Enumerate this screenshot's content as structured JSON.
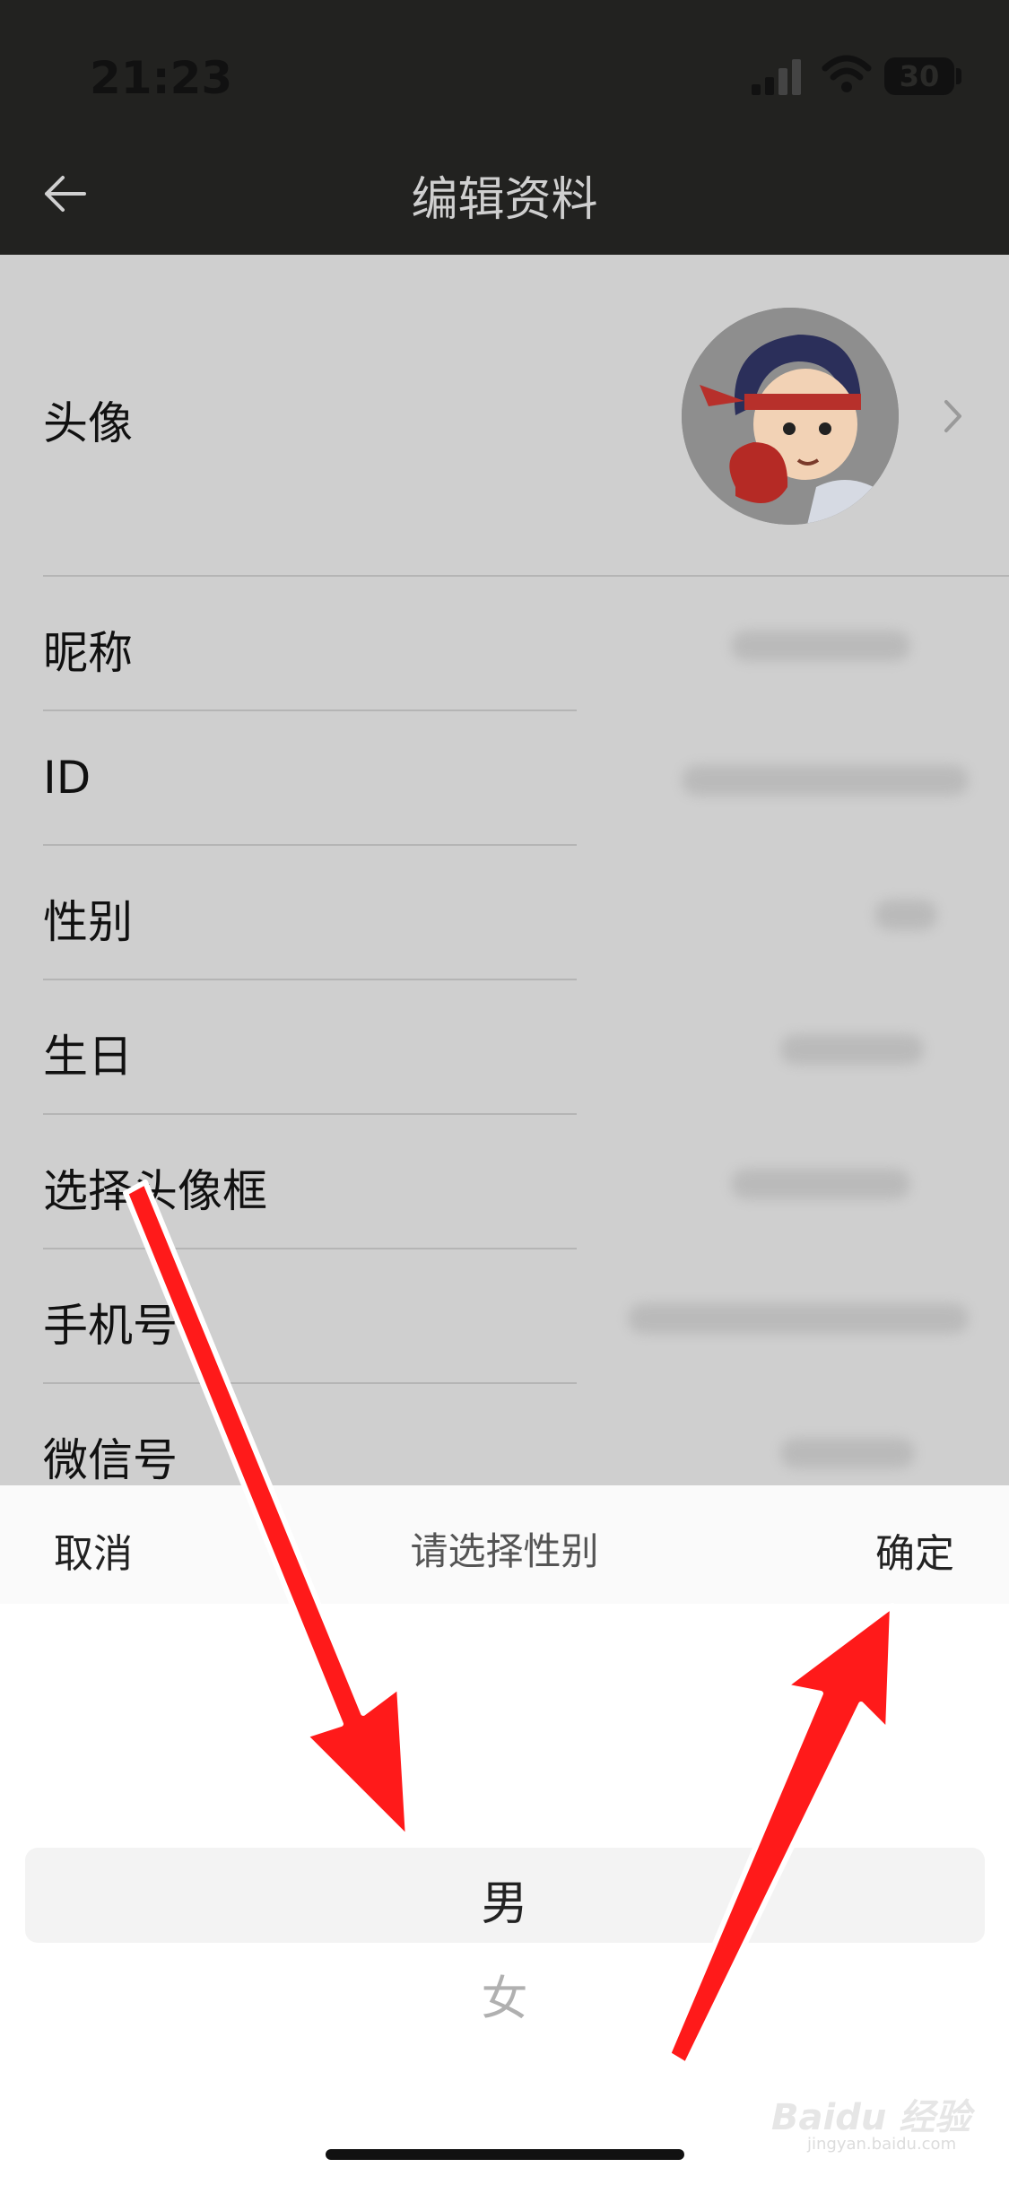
{
  "status_bar": {
    "time": "21:23",
    "battery": "30"
  },
  "nav": {
    "title": "编辑资料",
    "back_icon": "arrow-left-icon"
  },
  "profile": {
    "avatar_label": "头像",
    "fields": [
      {
        "label": "昵称"
      },
      {
        "label": "ID"
      },
      {
        "label": "性别"
      },
      {
        "label": "生日"
      },
      {
        "label": "选择头像框"
      },
      {
        "label": "手机号"
      },
      {
        "label": "微信号"
      }
    ]
  },
  "gender_picker": {
    "cancel": "取消",
    "title": "请选择性别",
    "confirm": "确定",
    "options": [
      "男",
      "女"
    ],
    "selected": "男"
  },
  "watermark": {
    "brand": "Baidu 经验",
    "url": "jingyan.baidu.com"
  },
  "annotation_color": "#ff1a1a"
}
